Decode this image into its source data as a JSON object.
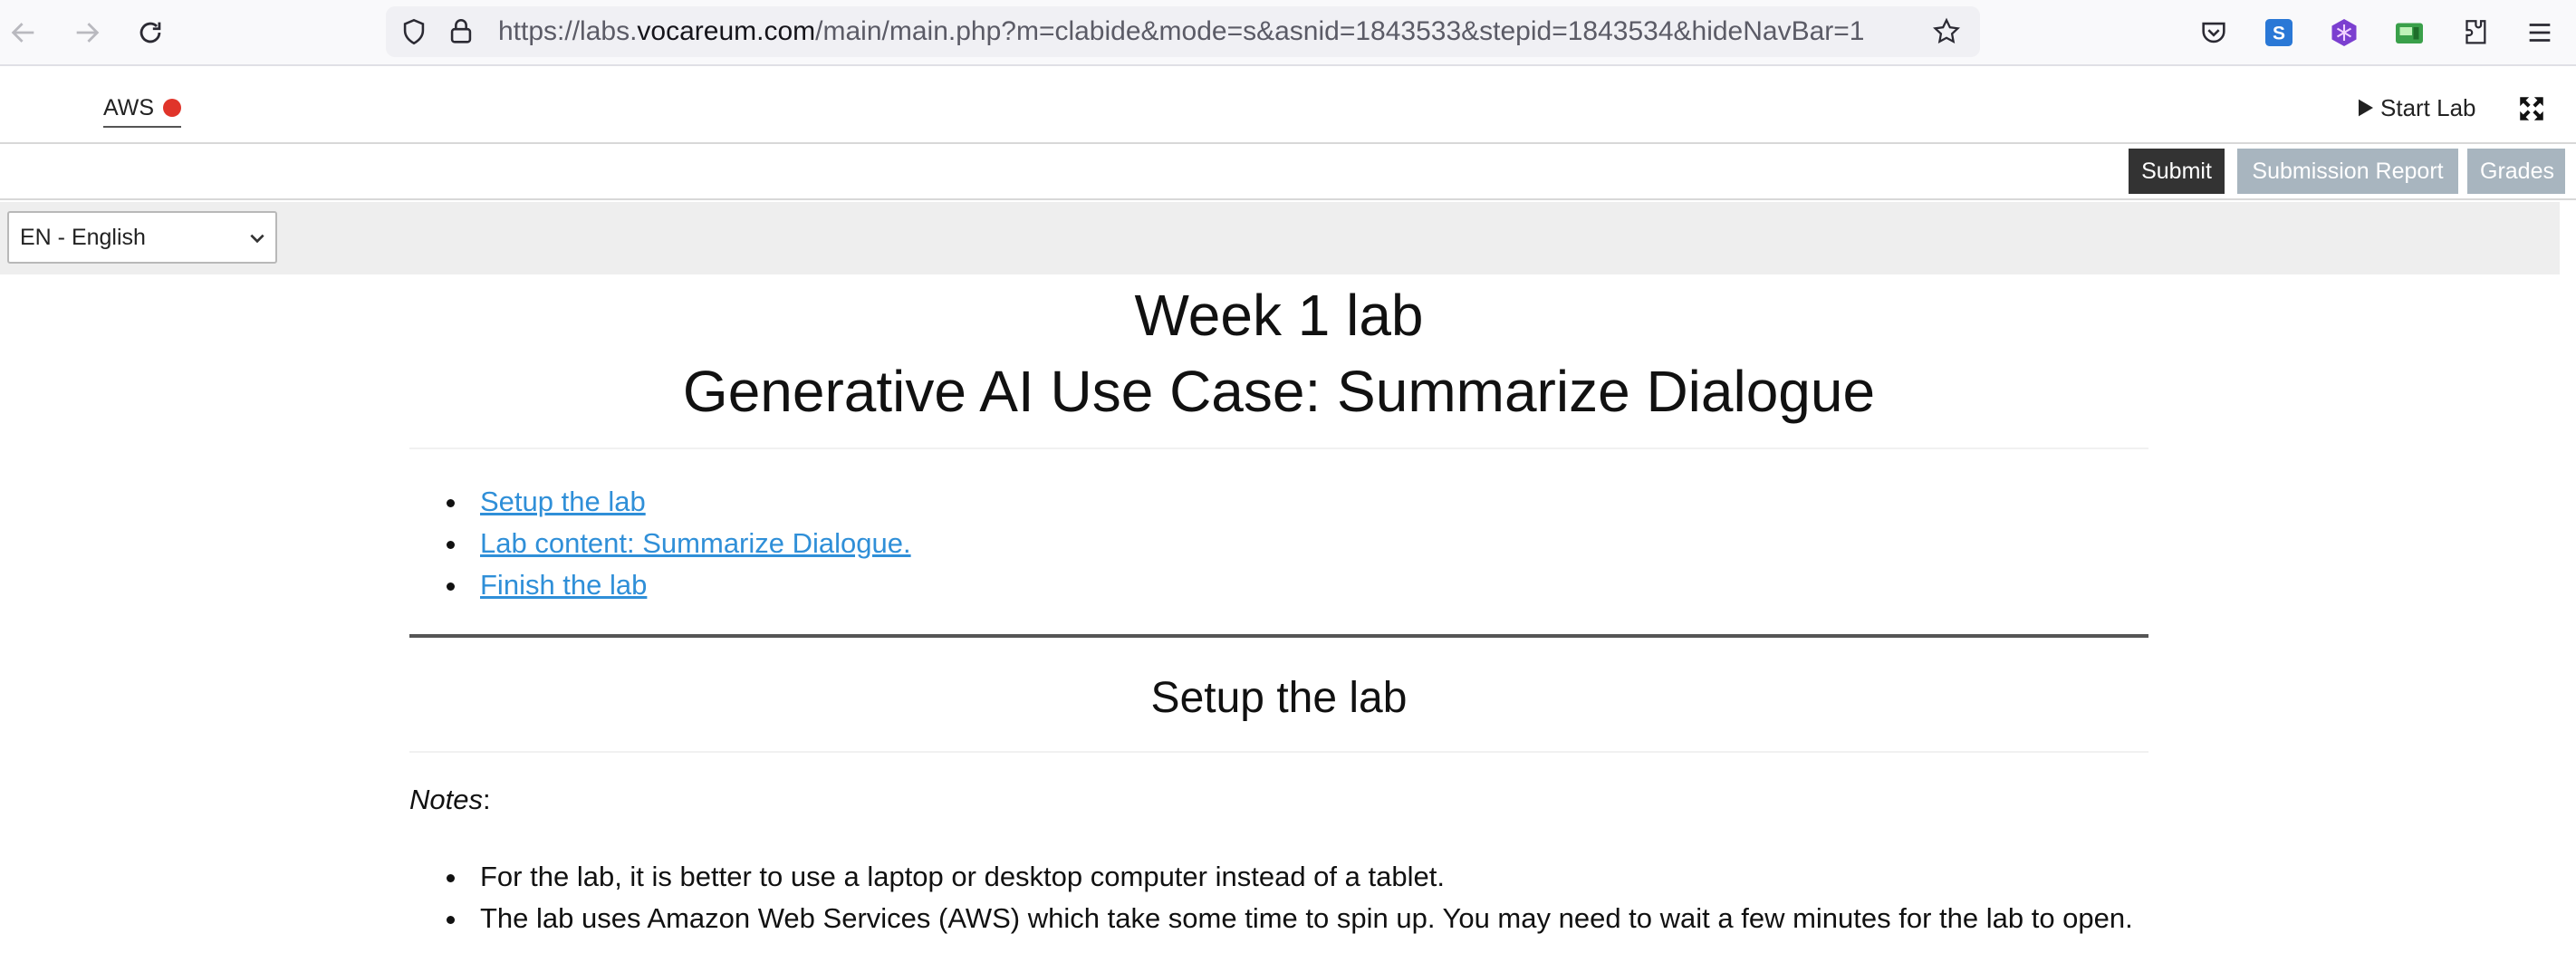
{
  "browser": {
    "url_prefix": "https://labs.",
    "url_host": "vocareum.com",
    "url_path": "/main/main.php?m=clabide&mode=s&asnid=1843533&stepid=1843534&hideNavBar=1",
    "icons": [
      "back-arrow-icon",
      "forward-arrow-icon",
      "reload-icon",
      "shield-icon",
      "lock-icon",
      "star-icon",
      "pocket-icon",
      "extension-s-icon",
      "extension-purple-icon",
      "extension-green-icon",
      "puzzle-icon",
      "menu-icon"
    ]
  },
  "app": {
    "aws_label": "AWS",
    "status_color": "#e0342a",
    "start_lab_label": "Start Lab",
    "expand_icon": "expand-icon"
  },
  "actions": {
    "submit_label": "Submit",
    "report_label": "Submission Report",
    "grades_label": "Grades"
  },
  "language": {
    "selected": "EN - English"
  },
  "content": {
    "title_line1": "Week 1 lab",
    "title_line2": "Generative AI Use Case: Summarize Dialogue",
    "toc": [
      "Setup the lab",
      "Lab content: Summarize Dialogue.",
      "Finish the lab"
    ],
    "section_heading": "Setup the lab",
    "notes_label": "Notes",
    "notes_colon": ":",
    "bullets": [
      "For the lab, it is better to use a laptop or desktop computer instead of a tablet.",
      "The lab uses Amazon Web Services (AWS) which take some time to spin up. You may need to wait a few minutes for the lab to open."
    ],
    "link_color": "#2f8fd8"
  }
}
